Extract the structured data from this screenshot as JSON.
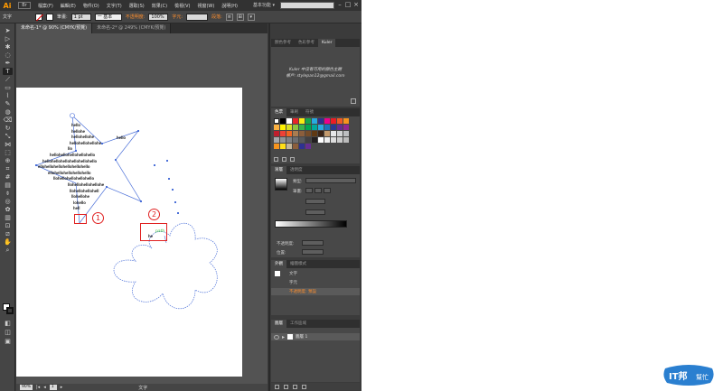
{
  "app": {
    "logo": "Ai",
    "bridge": "Br",
    "workspace": "基本功能 ▾",
    "menu": [
      "檔案(F)",
      "編輯(E)",
      "物件(O)",
      "文字(T)",
      "選取(S)",
      "效果(C)",
      "檢視(V)",
      "視窗(W)",
      "說明(H)"
    ]
  },
  "control_bar": {
    "tool_label": "文字",
    "stroke_label": "筆畫:",
    "stroke_value": "1 pt",
    "stroke_style": "一 基本",
    "opacity_link": "不透明度:",
    "opacity_value": "100%",
    "char_link": "字元:",
    "para_link": "段落:"
  },
  "tabs": [
    {
      "label": "未命名-1* @ 90% (CMYK/預覽)",
      "active": true
    },
    {
      "label": "未命名-2* @ 249% (CMYK/預覽)",
      "active": false
    }
  ],
  "canvas": {
    "star_text_lines": [
      "hello",
      "hellohe",
      "hellohellohe",
      "hellohellohellohe",
      "llo",
      "hellohellohellohellohello",
      "hellohellohellohellohellohello",
      "ellohellohellohellohellohello",
      "ellohellohellohellohello",
      "llohellohellohellohello",
      "llohellohellohellohe",
      "llohellohellohell",
      "llohellohe",
      "lohello",
      "hell"
    ],
    "small_text_1": "hello",
    "small_text_2": "he",
    "annotation_1": "1",
    "annotation_2": "2"
  },
  "status": {
    "zoom": "90%",
    "page": "1",
    "tool": "文字"
  },
  "panels": {
    "color_tabs": [
      "顏色參考",
      "色彩參考",
      "Kuler"
    ],
    "kuler_message_1": "Kuler 中沒有可用的顏色主題",
    "kuler_message_2": "帳戶: stylepan12@gmail.com",
    "swatches_tabs": [
      "色票",
      "筆刷",
      "符號"
    ],
    "gradient_tabs": [
      "漸層",
      "透明度"
    ],
    "gradient_type": "類型:",
    "gradient_stroke": "筆畫:",
    "gradient_opacity": "不透明度:",
    "gradient_location": "位置:",
    "appearance_tabs": [
      "外觀",
      "繪圖樣式"
    ],
    "appearance_title": "文字",
    "appearance_char": "字元",
    "appearance_opacity": "不透明度: 預設",
    "layers_tabs": [
      "圖層",
      "工作區域"
    ],
    "layer_name": "圖層 1"
  },
  "colors": {
    "accent_orange": "#ff8f2e",
    "annotation_red": "#e02020",
    "path_blue": "#4a6fd8"
  }
}
